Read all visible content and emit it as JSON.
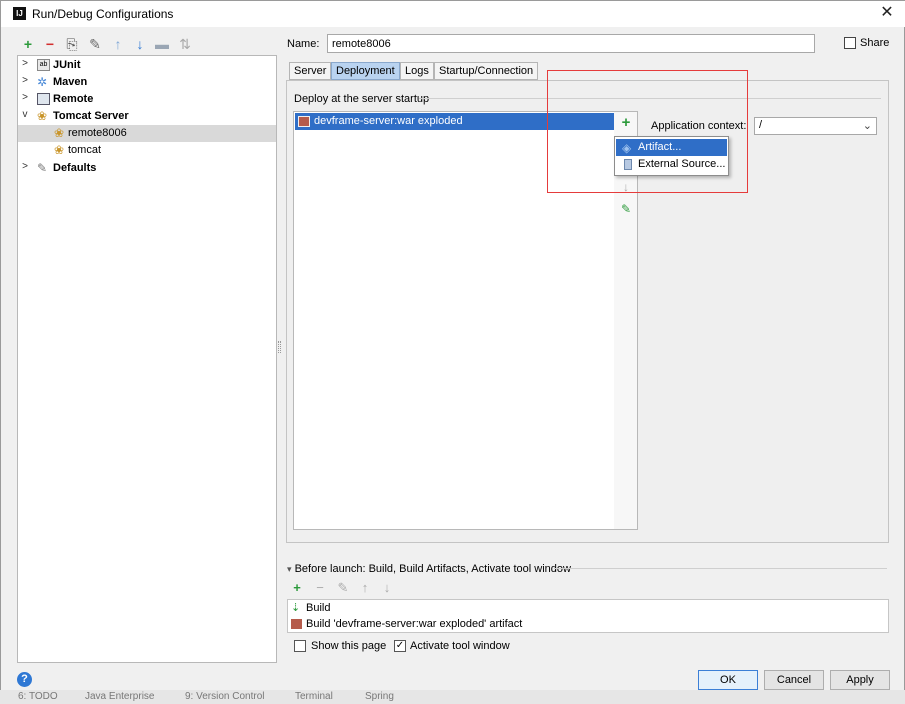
{
  "window": {
    "title": "Run/Debug Configurations",
    "icon_text": "IJ"
  },
  "toolbar": {
    "add_icon": "+",
    "remove_icon": "−",
    "copy_icon": "⎘",
    "wrench_icon": "✎",
    "up_icon": "↑",
    "down_icon": "↓",
    "folder_icon": "▬",
    "sort_icon": "⇅"
  },
  "tree": {
    "items": [
      {
        "label": "JUnit",
        "bold": true,
        "arrow": ">"
      },
      {
        "label": "Maven",
        "bold": true,
        "arrow": ">"
      },
      {
        "label": "Remote",
        "bold": true,
        "arrow": ">"
      },
      {
        "label": "Tomcat Server",
        "bold": true,
        "arrow": "v"
      },
      {
        "label": "remote8006",
        "bold": false,
        "selected": true
      },
      {
        "label": "tomcat",
        "bold": false
      },
      {
        "label": "Defaults",
        "bold": true,
        "arrow": ">"
      }
    ]
  },
  "name": {
    "label": "Name:",
    "value": "remote8006"
  },
  "share": {
    "label": "Share",
    "checked": false
  },
  "tabs": [
    {
      "label": "Server",
      "active": false
    },
    {
      "label": "Deployment",
      "active": true
    },
    {
      "label": "Logs",
      "active": false
    },
    {
      "label": "Startup/Connection",
      "active": false
    }
  ],
  "deployment": {
    "section_title": "Deploy at the server startup",
    "items": [
      "devframe-server:war exploded"
    ],
    "side_tools": {
      "add": "+",
      "down": "↓",
      "edit": "✎"
    },
    "app_context_label": "Application context:",
    "app_context_value": "/"
  },
  "popup": {
    "items": [
      {
        "label": "Artifact...",
        "selected": true
      },
      {
        "label": "External Source...",
        "selected": false
      }
    ]
  },
  "before_launch": {
    "title": "Before launch: Build, Build Artifacts, Activate tool window",
    "tools": {
      "add": "+",
      "remove": "−",
      "edit": "✎",
      "up": "↑",
      "down": "↓"
    },
    "items": [
      "Build",
      "Build 'devframe-server:war exploded' artifact"
    ]
  },
  "options": {
    "show_page": {
      "label": "Show this page",
      "checked": false
    },
    "activate_tool": {
      "label": "Activate tool window",
      "checked": true
    }
  },
  "buttons": {
    "ok": "OK",
    "cancel": "Cancel",
    "apply": "Apply",
    "help": "?"
  },
  "colors": {
    "accent": "#2f6ec7",
    "tab_active": "#b9d3f0",
    "highlight": "#e53b3b",
    "add_green": "#2c9a3b",
    "remove_red": "#d32f2f"
  },
  "background": {
    "items": [
      "6: TODO",
      "Java Enterprise",
      "9: Version Control",
      "Terminal",
      "Spring"
    ]
  }
}
